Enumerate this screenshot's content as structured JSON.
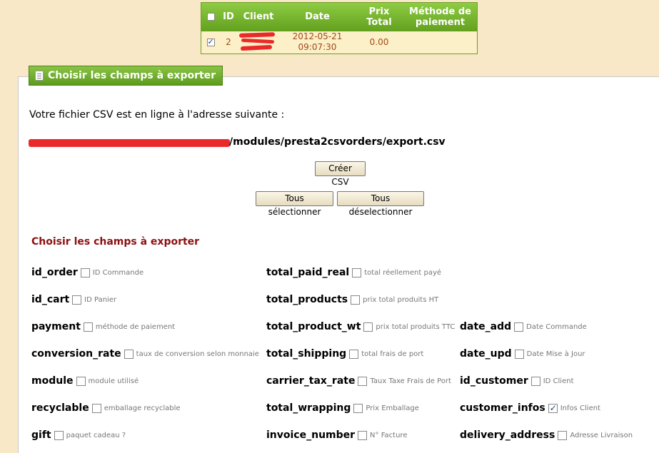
{
  "orders_table": {
    "headers": {
      "id": "ID",
      "client": "Client",
      "date": "Date",
      "prix_line1": "Prix",
      "prix_line2": "Total",
      "methode_line1": "Méthode de",
      "methode_line2": "paiement"
    },
    "row": {
      "id": "2",
      "date_line1": "2012-05-21",
      "date_line2": "09:07:30",
      "total": "0.00",
      "selected": true
    }
  },
  "legend_title": "Choisir les champs à exporter",
  "csv_message": "Votre fichier CSV est en ligne à l'adresse suivante :",
  "csv_path": "/modules/presta2csvorders/export.csv",
  "buttons": {
    "create_csv": "Créer CSV",
    "select_all": "Tous sélectionner",
    "deselect_all": "Tous déselectionner"
  },
  "fields_title": "Choisir les champs à exporter",
  "fields": {
    "id_order": {
      "name": "id_order",
      "desc": "ID Commande",
      "checked": false
    },
    "id_cart": {
      "name": "id_cart",
      "desc": "ID Panier",
      "checked": false
    },
    "payment": {
      "name": "payment",
      "desc": "méthode de paiement",
      "checked": false
    },
    "conversion_rate": {
      "name": "conversion_rate",
      "desc": "taux de conversion selon monnaie",
      "checked": false
    },
    "module": {
      "name": "module",
      "desc": "module utilisé",
      "checked": false
    },
    "recyclable": {
      "name": "recyclable",
      "desc": "emballage recyclable",
      "checked": false
    },
    "gift": {
      "name": "gift",
      "desc": "paquet cadeau ?",
      "checked": false
    },
    "total_paid_real": {
      "name": "total_paid_real",
      "desc": "total réellement payé",
      "checked": false
    },
    "total_products": {
      "name": "total_products",
      "desc": "prix total produits HT",
      "checked": false
    },
    "total_product_wt": {
      "name": "total_product_wt",
      "desc": "prix total produits TTC",
      "checked": false
    },
    "total_shipping": {
      "name": "total_shipping",
      "desc": "total frais de port",
      "checked": false
    },
    "carrier_tax_rate": {
      "name": "carrier_tax_rate",
      "desc": "Taux Taxe Frais de Port",
      "checked": false
    },
    "total_wrapping": {
      "name": "total_wrapping",
      "desc": "Prix Emballage",
      "checked": false
    },
    "invoice_number": {
      "name": "invoice_number",
      "desc": "N° Facture",
      "checked": false
    },
    "date_add": {
      "name": "date_add",
      "desc": "Date Commande",
      "checked": false
    },
    "date_upd": {
      "name": "date_upd",
      "desc": "Date Mise à Jour",
      "checked": false
    },
    "id_customer": {
      "name": "id_customer",
      "desc": "ID Client",
      "checked": false
    },
    "customer_infos": {
      "name": "customer_infos",
      "desc": "Infos Client",
      "checked": true
    },
    "delivery_address": {
      "name": "delivery_address",
      "desc": "Adresse Livraison",
      "checked": false
    }
  },
  "colors": {
    "accent_green": "#6cab2a",
    "title_red": "#8b1010",
    "page_bg": "#f9e8c8"
  }
}
